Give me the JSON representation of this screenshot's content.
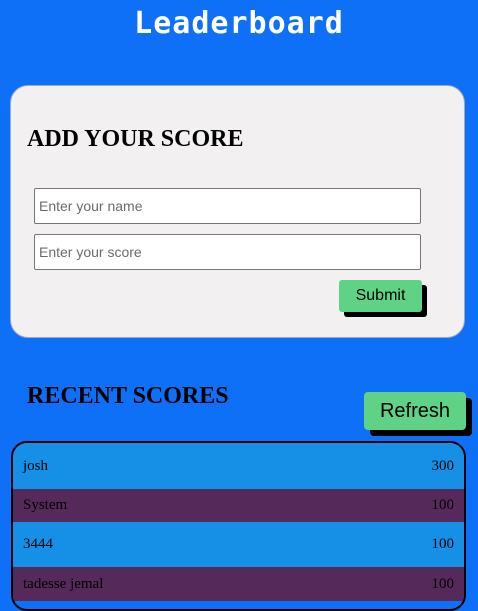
{
  "header": {
    "title": "Leaderboard"
  },
  "add_score": {
    "heading": "ADD YOUR SCORE",
    "name_placeholder": "Enter your name",
    "score_placeholder": "Enter your score",
    "submit_label": "Submit"
  },
  "recent": {
    "heading": "RECENT SCORES",
    "refresh_label": "Refresh",
    "rows": [
      {
        "name": "josh",
        "score": "300"
      },
      {
        "name": "System",
        "score": "100"
      },
      {
        "name": "3444",
        "score": "100"
      },
      {
        "name": "tadesse jemal",
        "score": "100"
      }
    ]
  },
  "colors": {
    "background": "#0e6ff7",
    "card": "#f2f0f1",
    "button": "#5fd286",
    "row_blue": "#1690e6",
    "row_purple": "#55295a"
  }
}
